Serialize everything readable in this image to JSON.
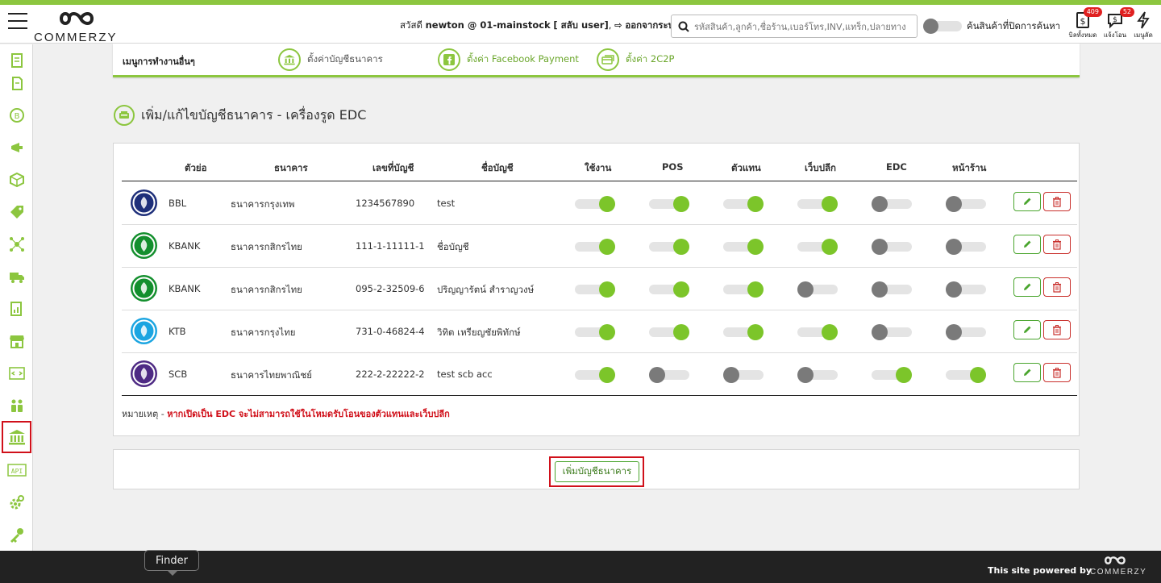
{
  "header": {
    "brand": "COMMERZY",
    "greeting_prefix": "สวัสดี",
    "greeting_user": "newton @ 01-mainstock",
    "switch_user": "[ สลับ user]",
    "logout": "ออกจากระบบ",
    "search_placeholder": "รหัสสินค้า,ลูกค้า,ชื่อร้าน,เบอร์โทร,INV,แทร็ก,ปลายทาง",
    "search_hidden_label": "ค้นสินค้าที่ปิดการค้นหา",
    "icons": [
      {
        "label": "บิลทั้งหมด",
        "badge": "409"
      },
      {
        "label": "แจ้งโอน",
        "badge": "52"
      },
      {
        "label": "เมนูลัด",
        "badge": ""
      }
    ]
  },
  "other_menu": {
    "title": "เมนูการทำงานอื่นๆ",
    "items": [
      {
        "label": "ตั้งค่าบัญชีธนาคาร",
        "icon": "bank-icon"
      },
      {
        "label": "ตั้งค่า Facebook Payment",
        "icon": "facebook-icon"
      },
      {
        "label": "ตั้งค่า 2C2P",
        "icon": "card-icon"
      }
    ]
  },
  "page_title": "เพิ่ม/แก้ไขบัญชีธนาคาร - เครื่องรูด EDC",
  "table": {
    "headers": [
      "ตัวย่อ",
      "ธนาคาร",
      "เลขที่บัญชี",
      "ชื่อบัญชี",
      "ใช้งาน",
      "POS",
      "ตัวแทน",
      "เว็บปลีก",
      "EDC",
      "หน้าร้าน"
    ],
    "rows": [
      {
        "abbr": "BBL",
        "bank": "ธนาคารกรุงเทพ",
        "account": "1234567890",
        "name": "test",
        "toggles": [
          true,
          true,
          true,
          true,
          false,
          false
        ],
        "logo_color": "#1e2f7a"
      },
      {
        "abbr": "KBANK",
        "bank": "ธนาคารกสิกรไทย",
        "account": "111-1-11111-1",
        "name": "ชื่อบัญชี",
        "toggles": [
          true,
          true,
          true,
          true,
          false,
          false
        ],
        "logo_color": "#138f2d"
      },
      {
        "abbr": "KBANK",
        "bank": "ธนาคารกสิกรไทย",
        "account": "095-2-32509-6",
        "name": "ปริญญารัตน์ สำราญวงษ์",
        "toggles": [
          true,
          true,
          true,
          false,
          false,
          false
        ],
        "logo_color": "#138f2d"
      },
      {
        "abbr": "KTB",
        "bank": "ธนาคารกรุงไทย",
        "account": "731-0-46824-4",
        "name": "วิทิต เหรียญชัยพิทักษ์",
        "toggles": [
          true,
          true,
          true,
          true,
          false,
          false
        ],
        "logo_color": "#1ba5e1"
      },
      {
        "abbr": "SCB",
        "bank": "ธนาคารไทยพาณิชย์",
        "account": "222-2-22222-2",
        "name": "test scb acc",
        "toggles": [
          true,
          false,
          false,
          false,
          true,
          true
        ],
        "logo_color": "#4e2a84"
      }
    ]
  },
  "note_prefix": "หมายเหตุ -",
  "note_text": "หากเปิดเป็น EDC จะไม่สามารถใช้ในโหมดรับโอนของตัวแทนและเว็บปลีก",
  "add_button": "เพิ่มบัญชีธนาคาร",
  "footer": {
    "powered": "This site powered by",
    "brand": "COMMERZY"
  },
  "tooltip": "Finder",
  "colors": {
    "accent": "#8cc63f",
    "danger": "#d0101a",
    "toggle_on": "#7cc52a"
  }
}
